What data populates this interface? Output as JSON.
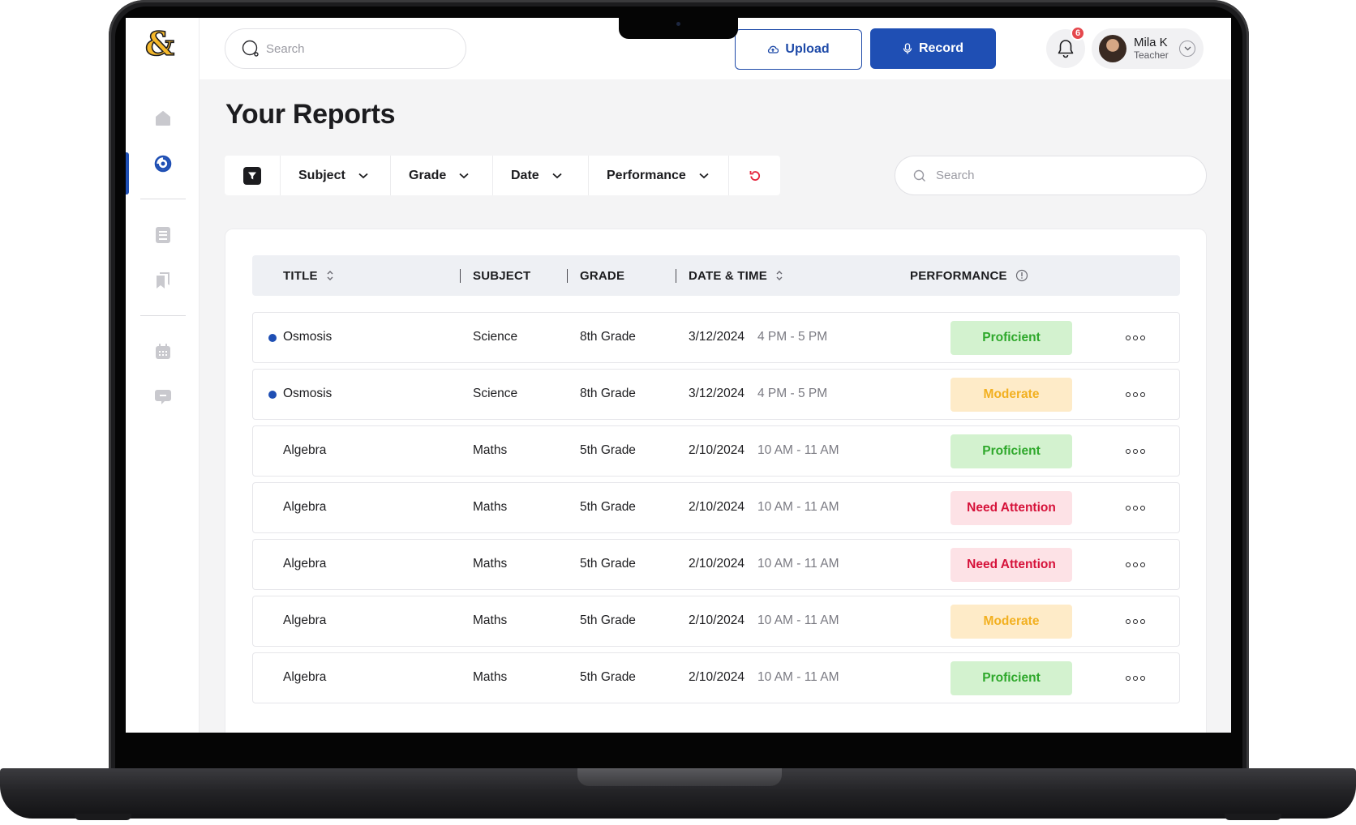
{
  "header": {
    "search_placeholder": "Search",
    "upload_label": "Upload",
    "record_label": "Record",
    "notification_count": "6",
    "user": {
      "name": "Mila K",
      "role": "Teacher"
    }
  },
  "page": {
    "title": "Your Reports"
  },
  "filters": {
    "subject": "Subject",
    "grade": "Grade",
    "date": "Date",
    "performance": "Performance",
    "search_placeholder": "Search"
  },
  "table": {
    "columns": {
      "title": "TITLE",
      "subject": "SUBJECT",
      "grade": "GRADE",
      "datetime": "DATE & TIME",
      "performance": "PERFORMANCE"
    },
    "rows": [
      {
        "title": "Osmosis",
        "unread": true,
        "subject": "Science",
        "grade": "8th Grade",
        "date": "3/12/2024",
        "time": "4 PM - 5 PM",
        "performance": "Proficient",
        "status": "proficient"
      },
      {
        "title": "Osmosis",
        "unread": true,
        "subject": "Science",
        "grade": "8th Grade",
        "date": "3/12/2024",
        "time": "4 PM - 5 PM",
        "performance": "Moderate",
        "status": "moderate"
      },
      {
        "title": "Algebra",
        "unread": false,
        "subject": "Maths",
        "grade": "5th Grade",
        "date": "2/10/2024",
        "time": "10 AM - 11 AM",
        "performance": "Proficient",
        "status": "proficient"
      },
      {
        "title": "Algebra",
        "unread": false,
        "subject": "Maths",
        "grade": "5th Grade",
        "date": "2/10/2024",
        "time": "10 AM - 11 AM",
        "performance": "Need Attention",
        "status": "attention"
      },
      {
        "title": "Algebra",
        "unread": false,
        "subject": "Maths",
        "grade": "5th Grade",
        "date": "2/10/2024",
        "time": "10 AM - 11 AM",
        "performance": "Need Attention",
        "status": "attention"
      },
      {
        "title": "Algebra",
        "unread": false,
        "subject": "Maths",
        "grade": "5th Grade",
        "date": "2/10/2024",
        "time": "10 AM - 11 AM",
        "performance": "Moderate",
        "status": "moderate"
      },
      {
        "title": "Algebra",
        "unread": false,
        "subject": "Maths",
        "grade": "5th Grade",
        "date": "2/10/2024",
        "time": "10 AM - 11 AM",
        "performance": "Proficient",
        "status": "proficient"
      }
    ]
  },
  "sidebar": {
    "items": [
      {
        "icon": "home-icon"
      },
      {
        "icon": "reports-icon",
        "active": true
      },
      {
        "icon": "document-icon"
      },
      {
        "icon": "library-icon"
      },
      {
        "icon": "calendar-icon"
      },
      {
        "icon": "chat-icon"
      }
    ]
  },
  "colors": {
    "brand": "#1f4fb4",
    "logo": "#f5b82a",
    "proficient": "#2ea82b",
    "moderate": "#f2b020",
    "attention": "#d6123a"
  }
}
